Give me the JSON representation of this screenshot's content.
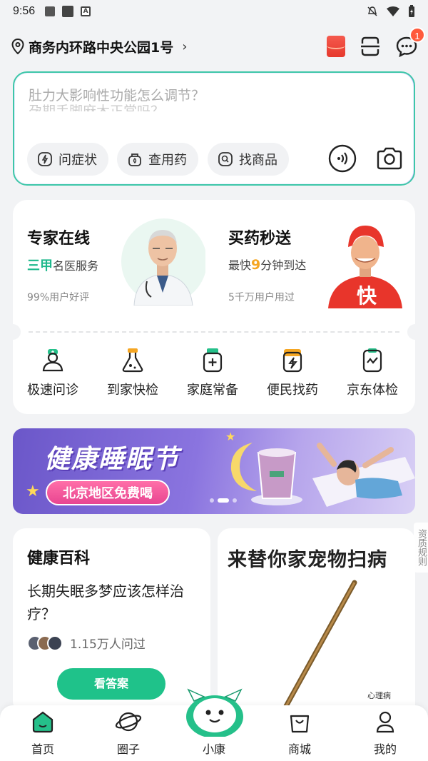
{
  "status_bar": {
    "time": "9:56"
  },
  "location": {
    "address": "商务内环路中央公园1号",
    "chevron": "›"
  },
  "header": {
    "message_badge": "1"
  },
  "search": {
    "placeholder_line1": "肚力大影响性功能怎么调节？",
    "placeholder_line2": "孕期手脚麻木正常吗？",
    "chips": [
      {
        "label": "问症状",
        "icon": "symptom-icon"
      },
      {
        "label": "查用药",
        "icon": "medicine-icon"
      },
      {
        "label": "找商品",
        "icon": "product-search-icon"
      }
    ]
  },
  "services": {
    "expert": {
      "title": "专家在线",
      "hl": "三甲",
      "sub": "名医服务",
      "foot": "99%用户好评"
    },
    "delivery": {
      "title": "买药秒送",
      "pre": "最快",
      "hl": "9",
      "sub": "分钟到达",
      "foot": "5千万用户用过",
      "jacket": "快"
    },
    "quick": [
      {
        "label": "极速问诊",
        "icon": "doctor-consult-icon"
      },
      {
        "label": "到家快检",
        "icon": "flask-icon"
      },
      {
        "label": "家庭常备",
        "icon": "medicine-bottle-icon"
      },
      {
        "label": "便民找药",
        "icon": "pill-box-icon"
      },
      {
        "label": "京东体检",
        "icon": "health-check-icon"
      }
    ]
  },
  "banner": {
    "title": "健康睡眠节",
    "pill": "北京地区免费喝"
  },
  "side_tag": "资质规则",
  "wiki": {
    "title": "健康百科",
    "question": "长期失眠多梦应该怎样治疗？",
    "askers": "1.15万人问过",
    "button": "看答案"
  },
  "pet": {
    "title": "来替你家宠物扫病",
    "mini": "心理病"
  },
  "tabs": [
    {
      "label": "首页",
      "icon": "home-icon"
    },
    {
      "label": "圈子",
      "icon": "planet-icon"
    },
    {
      "label": "小康",
      "icon": "mascot-icon"
    },
    {
      "label": "商城",
      "icon": "shopping-bag-icon"
    },
    {
      "label": "我的",
      "icon": "profile-icon"
    }
  ],
  "colors": {
    "accent": "#1fc28a",
    "brand_green": "#3ec7a8",
    "badge_red": "#ff5a3c"
  }
}
